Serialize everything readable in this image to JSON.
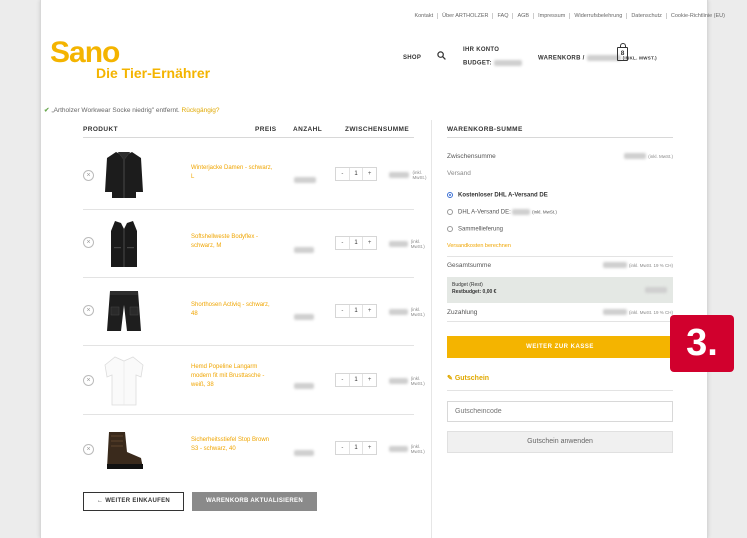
{
  "topnav": [
    "Kontakt",
    "Über ARTHOLZER",
    "FAQ",
    "AGB",
    "Impressum",
    "Widerrufsbelehrung",
    "Datenschutz",
    "Cookie-Richtlinie (EU)"
  ],
  "brand": {
    "name": "Sano",
    "tagline": "Die Tier-Ernährer",
    "color": "#f4b400"
  },
  "header": {
    "shop": "SHOP",
    "account": "IHR KONTO",
    "budget": "BUDGET:",
    "cart": "WARENKORB /",
    "cart_vat": "(INKL. MWST.)",
    "cart_count": "8"
  },
  "notice": {
    "text": "„Artholzer Workwear Socke niedrig\" entfernt.",
    "undo": "Rückgängig?"
  },
  "table": {
    "headers": {
      "product": "PRODUKT",
      "price": "PREIS",
      "qty": "ANZAHL",
      "subtotal": "ZWISCHENSUMME"
    },
    "unit_label": "(inkl. MwSt.)",
    "rows": [
      {
        "name": "Winterjacke Damen - schwarz, L",
        "qty": "1",
        "image": "jacket"
      },
      {
        "name": "Softshellweste Bodyflex - schwarz, M",
        "qty": "1",
        "image": "vest"
      },
      {
        "name": "Shorthosen Activiq - schwarz, 48",
        "qty": "1",
        "image": "shorts"
      },
      {
        "name": "Hemd Popeline Langarm modern fit mit Brusttasche - weiß, 38",
        "qty": "1",
        "image": "shirt"
      },
      {
        "name": "Sicherheitsstiefel Stop Brown S3 - schwarz, 40",
        "qty": "1",
        "image": "boot"
      }
    ]
  },
  "buttons": {
    "continue": "← WEITER EINKAUFEN",
    "update": "WARENKORB AKTUALISIEREN"
  },
  "summary": {
    "title": "WARENKORB-SUMME",
    "subtotal_label": "Zwischensumme",
    "vat_note": "(inkl. MwSt.)",
    "shipping_label": "Versand",
    "shipping_options": [
      {
        "label": "Kostenloser DHL A-Versand DE",
        "selected": true
      },
      {
        "label": "DHL A-Versand DE:",
        "selected": false
      },
      {
        "label": "Sammellieferung",
        "selected": false
      }
    ],
    "shipping_calc": "Versandkosten berechnen",
    "total_label": "Gesamtsumme",
    "total_note": "(inkl. MwSt. 19 % CH)",
    "budget_line1": "Budget (Rest)",
    "budget_line2": "Restbudget: 0,00 €",
    "payment_label": "Zuzahlung",
    "payment_note": "(inkl. MwSt. 19 % CH)",
    "checkout": "WEITER ZUR KASSE",
    "coupon_title": "Gutschein",
    "coupon_placeholder": "Gutscheincode",
    "coupon_button": "Gutschein anwenden"
  },
  "step_badge": "3.",
  "colors": {
    "accent": "#f4b400",
    "badge": "#d1002d",
    "radio": "#3b6fd4"
  }
}
